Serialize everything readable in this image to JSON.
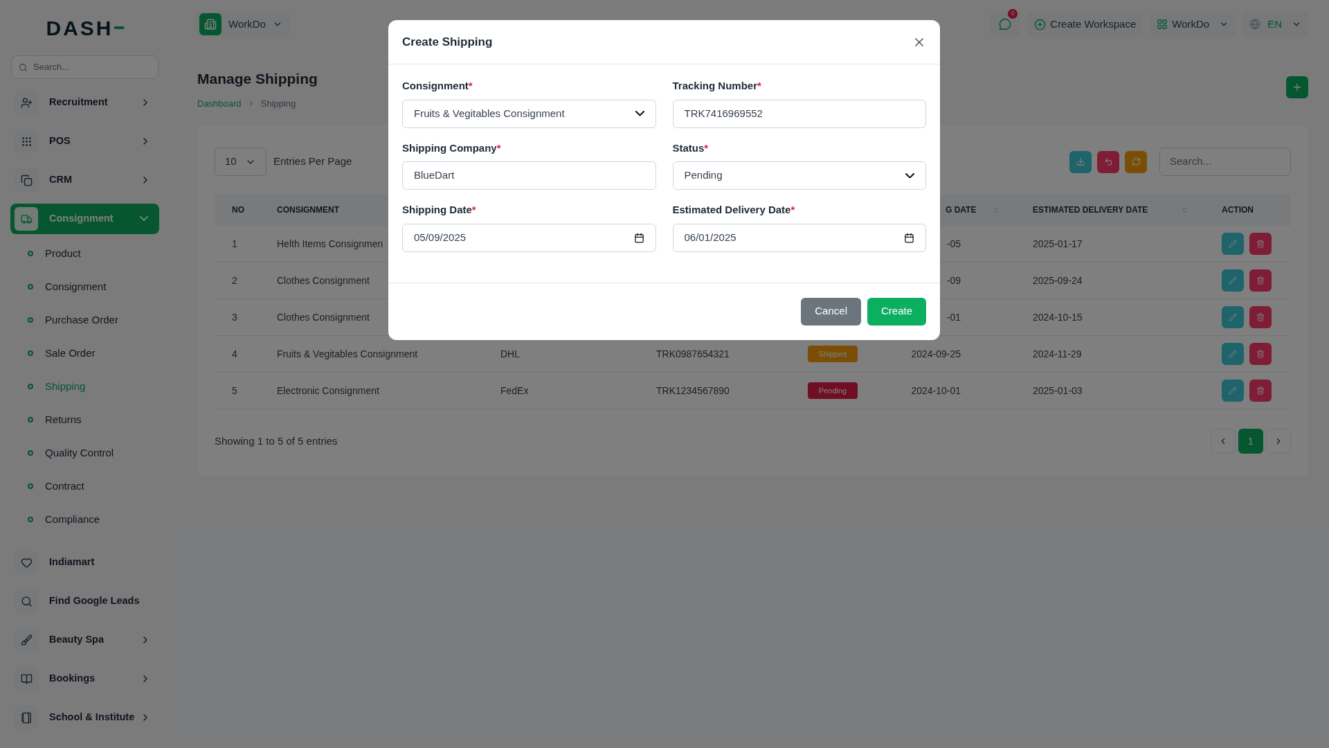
{
  "sidebar": {
    "logo": "DASH",
    "search": {
      "placeholder": "Search..."
    },
    "items": [
      {
        "label": "Recruitment",
        "kind": "group",
        "expanded": false,
        "selected": false
      },
      {
        "label": "POS",
        "kind": "group",
        "expanded": false,
        "selected": false
      },
      {
        "label": "CRM",
        "kind": "group",
        "expanded": false,
        "selected": false
      },
      {
        "label": "Consignment",
        "kind": "group",
        "expanded": true,
        "selected": true,
        "children": [
          {
            "label": "Product",
            "selected": false
          },
          {
            "label": "Consignment",
            "selected": false
          },
          {
            "label": "Purchase Order",
            "selected": false
          },
          {
            "label": "Sale Order",
            "selected": false
          },
          {
            "label": "Shipping",
            "selected": true
          },
          {
            "label": "Returns",
            "selected": false
          },
          {
            "label": "Quality Control",
            "selected": false
          },
          {
            "label": "Contract",
            "selected": false
          },
          {
            "label": "Compliance",
            "selected": false
          }
        ]
      },
      {
        "label": "Indiamart",
        "kind": "link",
        "selected": false
      },
      {
        "label": "Find Google Leads",
        "kind": "link",
        "selected": false
      },
      {
        "label": "Beauty Spa",
        "kind": "group",
        "expanded": false,
        "selected": false
      },
      {
        "label": "Bookings",
        "kind": "group",
        "expanded": false,
        "selected": false
      },
      {
        "label": "School & Institute",
        "kind": "group",
        "expanded": false,
        "selected": false
      }
    ]
  },
  "header": {
    "workspace": "WorkDo",
    "messages_badge": "0",
    "create_workspace": "Create Workspace",
    "user": "WorkDo",
    "language": "EN"
  },
  "page": {
    "title": "Manage Shipping",
    "breadcrumb": [
      "Dashboard",
      "Shipping"
    ]
  },
  "table": {
    "entries": "10",
    "entries_label": "Entries Per Page",
    "search": {
      "placeholder": "Search..."
    },
    "columns": [
      {
        "label": "NO",
        "sortable": false
      },
      {
        "label": "CONSIGNMENT",
        "sortable": false
      },
      {
        "label": "G DATE",
        "sortable": true
      },
      {
        "label": "ESTIMATED DELIVERY DATE",
        "sortable": true
      },
      {
        "label": "ACTION",
        "sortable": false
      }
    ],
    "rows": [
      {
        "no": "1",
        "consignment": "Helth Items Consignmen",
        "shipping_date": "-05",
        "estimated_delivery_date": "2025-01-17"
      },
      {
        "no": "2",
        "consignment": "Clothes Consignment",
        "shipping_date": "-09",
        "estimated_delivery_date": "2025-09-24"
      },
      {
        "no": "3",
        "consignment": "Clothes Consignment",
        "shipping_date": "-01",
        "estimated_delivery_date": "2024-10-15"
      },
      {
        "no": "4",
        "consignment": "Fruits & Vegitables Consignment",
        "shipping_company": "DHL",
        "tracking_number": "TRK0987654321",
        "status": {
          "label": "Shipped",
          "kind": "shipped"
        },
        "shipping_date": "2024-09-25",
        "estimated_delivery_date": "2024-11-29"
      },
      {
        "no": "5",
        "consignment": "Electronic Consignment",
        "shipping_company": "FedEx",
        "tracking_number": "TRK1234567890",
        "status": {
          "label": "Pending",
          "kind": "pending"
        },
        "shipping_date": "2024-10-01",
        "estimated_delivery_date": "2025-01-03"
      }
    ],
    "footer": "Showing 1 to 5 of 5 entries",
    "pages": [
      {
        "label": "1",
        "selected": true
      }
    ]
  },
  "modal": {
    "title": "Create Shipping",
    "fields": [
      {
        "label": "Consignment",
        "required_mark": "*",
        "kind": "select",
        "value": "Fruits & Vegitables Consignment"
      },
      {
        "label": "Tracking Number",
        "required_mark": "*",
        "kind": "text",
        "value": "TRK7416969552"
      },
      {
        "label": "Shipping Company",
        "required_mark": "*",
        "kind": "text",
        "value": "BlueDart"
      },
      {
        "label": "Status",
        "required_mark": "*",
        "kind": "select",
        "value": "Pending"
      },
      {
        "label": "Shipping Date",
        "required_mark": "*",
        "kind": "date",
        "value": "05/09/2025"
      },
      {
        "label": "Estimated Delivery Date",
        "required_mark": "*",
        "kind": "date",
        "value": "06/01/2025"
      }
    ],
    "buttons": [
      {
        "label": "Cancel",
        "kind": "secondary"
      },
      {
        "label": "Create",
        "kind": "primary"
      }
    ]
  }
}
